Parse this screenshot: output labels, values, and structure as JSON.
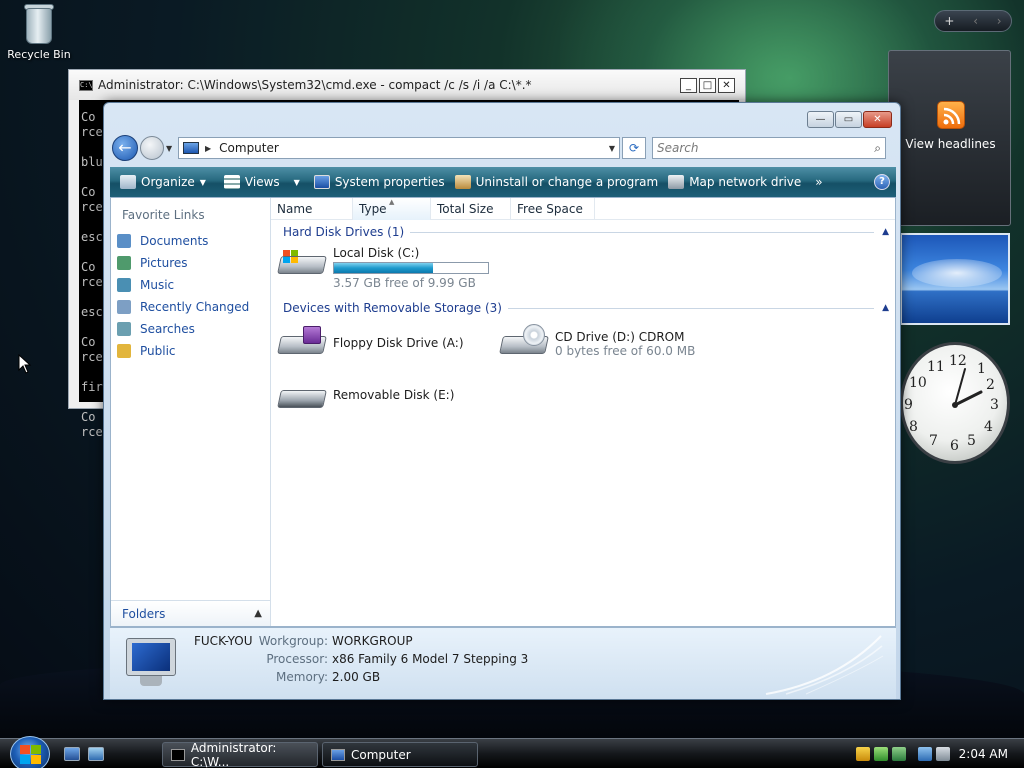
{
  "desktop": {
    "recycle_bin_label": "Recycle Bin"
  },
  "gadgets": {
    "feed_label": "View headlines",
    "controls": [
      "+",
      "‹",
      "›"
    ],
    "clock_numbers": [
      "12",
      "1",
      "2",
      "3",
      "4",
      "5",
      "6",
      "7",
      "8",
      "9",
      "10",
      "11"
    ],
    "clock_time": "2:04"
  },
  "cmd": {
    "title": "Administrator: C:\\Windows\\System32\\cmd.exe - compact  /c /s /i /a C:\\*.*",
    "icon_text": "C:\\",
    "buttons": {
      "minimize": "_",
      "maximize": "□",
      "close": "✕"
    },
    "lines": [
      "Co",
      "rce",
      "",
      "blu",
      "",
      "Co",
      "rce",
      "",
      "esc",
      "",
      "Co",
      "rce",
      "",
      "esc",
      "",
      "Co",
      "rce",
      "",
      "fir",
      "",
      "Co",
      "rce"
    ]
  },
  "explorer": {
    "buttons": {
      "minimize": "—",
      "maximize": "▭",
      "close": "✕"
    },
    "address": {
      "path": "Computer",
      "search_placeholder": "Search"
    },
    "toolbar": {
      "organize": "Organize",
      "views": "Views",
      "system_properties": "System properties",
      "uninstall": "Uninstall or change a program",
      "map_drive": "Map network drive",
      "more": "»",
      "help": "?"
    },
    "nav": {
      "favorites_title": "Favorite Links",
      "items": [
        {
          "label": "Documents",
          "color": "#5a8fc7"
        },
        {
          "label": "Pictures",
          "color": "#4f9a6c"
        },
        {
          "label": "Music",
          "color": "#4a8fb3"
        },
        {
          "label": "Recently Changed",
          "color": "#7d9fc4"
        },
        {
          "label": "Searches",
          "color": "#6b9fb0"
        },
        {
          "label": "Public",
          "color": "#e2b53c"
        }
      ],
      "folders_label": "Folders"
    },
    "columns": [
      "Name",
      "Type",
      "Total Size",
      "Free Space"
    ],
    "groups": {
      "hard_disks": "Hard Disk Drives (1)",
      "removable": "Devices with Removable Storage (3)"
    },
    "drives": {
      "c": {
        "name": "Local Disk (C:)",
        "free": "3.57 GB free of 9.99 GB",
        "used_fraction": 0.64
      },
      "a": {
        "name": "Floppy Disk Drive (A:)"
      },
      "d": {
        "name": "CD Drive (D:) CDROM",
        "free": "0 bytes free of 60.0 MB"
      },
      "e": {
        "name": "Removable Disk (E:)"
      }
    },
    "details": {
      "computer_name": "FUCK-YOU",
      "workgroup_label": "Workgroup:",
      "workgroup": "WORKGROUP",
      "processor_label": "Processor:",
      "processor": "x86 Family 6 Model 7 Stepping 3",
      "memory_label": "Memory:",
      "memory": "2.00 GB"
    }
  },
  "taskbar": {
    "tasks": [
      {
        "label": "Administrator: C:\\W..."
      },
      {
        "label": "Computer"
      }
    ],
    "clock": "2:04 AM"
  },
  "colors": {
    "toolbar_accent": "#1e5f78",
    "link_blue": "#1f4fa0",
    "usage_fill": "#1f9bcd"
  }
}
